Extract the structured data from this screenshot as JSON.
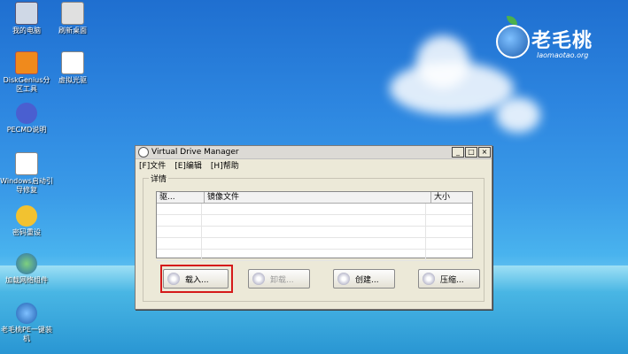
{
  "desktop": {
    "icons": [
      {
        "label": "我的电脑",
        "icon": "computer-icon"
      },
      {
        "label": "刷新桌面",
        "icon": "refresh-icon"
      },
      {
        "label": "DiskGenius分区工具",
        "icon": "diskgenius-icon"
      },
      {
        "label": "虚拟光驱",
        "icon": "virtual-drive-icon"
      },
      {
        "label": "PECMD说明",
        "icon": "help-icon"
      },
      {
        "label": "Windows启动引导修复",
        "icon": "boot-repair-icon"
      },
      {
        "label": "密码重设",
        "icon": "key-icon"
      },
      {
        "label": "加载网络组件",
        "icon": "network-icon"
      },
      {
        "label": "老毛桃PE一键装机",
        "icon": "installer-icon"
      }
    ],
    "logo": {
      "name": "老毛桃",
      "url": "laomaotao.org"
    }
  },
  "window": {
    "title": "Virtual Drive Manager",
    "controls": [
      "_",
      "□",
      "×"
    ],
    "menu": [
      "[F]文件",
      "[E]编辑",
      "[H]帮助"
    ],
    "group_label": "详情",
    "columns": [
      "驱...",
      "镜像文件",
      "大小"
    ],
    "rows": [],
    "buttons": [
      {
        "label": "载入...",
        "enabled": true,
        "highlighted": true
      },
      {
        "label": "卸载...",
        "enabled": false
      },
      {
        "label": "创建...",
        "enabled": true
      },
      {
        "label": "压缩...",
        "enabled": true
      }
    ]
  }
}
